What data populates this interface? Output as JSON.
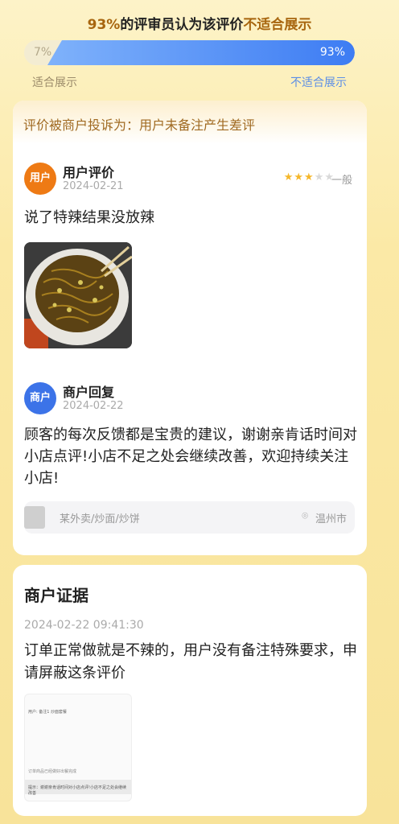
{
  "header": {
    "percent": "93%",
    "title_mid": "的评审员认为该评价",
    "title_tag": "不适合展示",
    "bar_left_value": "7%",
    "bar_right_value": "93%",
    "bar_right_fraction": 0.93,
    "label_left": "适合展示",
    "label_right": "不适合展示"
  },
  "complaint": {
    "text": "评价被商户投诉为：用户未备注产生差评"
  },
  "user_review": {
    "avatar": "用户",
    "name": "用户评价",
    "date": "2024-02-21",
    "stars": 3,
    "stars_max": 5,
    "rating_label": "一般",
    "text": "说了特辣结果没放辣",
    "photo_icon": "noodle-photo"
  },
  "merchant_reply": {
    "avatar": "商户",
    "name": "商户回复",
    "date": "2024-02-22",
    "text": "顾客的每次反馈都是宝贵的建议，谢谢亲肯话时间对小店点评!小店不足之处会继续改善，欢迎持续关注小店!"
  },
  "store": {
    "name": "某外卖/炒面/炒饼",
    "city": "温州市",
    "pin_icon": "location-pin-icon"
  },
  "evidence": {
    "title": "商户证据",
    "timestamp": "2024-02-22 09:41:30",
    "text": "订单正常做就是不辣的，用户没有备注特殊要求，申请屏蔽这条评价",
    "doc_line1": "用户: 备注1 炒面套餐",
    "doc_line2": "订单商品已经做好出餐完成",
    "doc_line3": "提示：谢谢亲肯话时间对小店点评!小店不足之处会继续改善"
  },
  "colors": {
    "accent_gold": "#a8660f",
    "accent_blue": "#3d7cf3",
    "user_avatar": "#ee7a14",
    "merchant_avatar": "#3c73e8",
    "star": "#f5b72b"
  }
}
